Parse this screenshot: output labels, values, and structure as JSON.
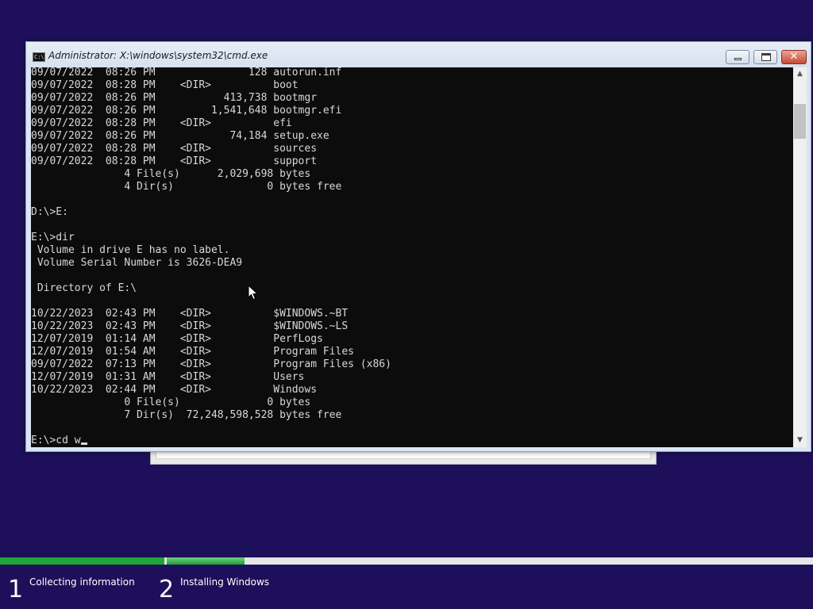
{
  "window": {
    "title": "Administrator: X:\\windows\\system32\\cmd.exe",
    "icon": "cmd-icon",
    "controls": [
      "minimize-icon",
      "maximize-icon",
      "close-icon"
    ],
    "close_glyph": "✕"
  },
  "console": {
    "lines": [
      "09/07/2022  08:26 PM               128 autorun.inf",
      "09/07/2022  08:28 PM    <DIR>          boot",
      "09/07/2022  08:26 PM           413,738 bootmgr",
      "09/07/2022  08:26 PM         1,541,648 bootmgr.efi",
      "09/07/2022  08:28 PM    <DIR>          efi",
      "09/07/2022  08:26 PM            74,184 setup.exe",
      "09/07/2022  08:28 PM    <DIR>          sources",
      "09/07/2022  08:28 PM    <DIR>          support",
      "               4 File(s)      2,029,698 bytes",
      "               4 Dir(s)               0 bytes free",
      "",
      "D:\\>E:",
      "",
      "E:\\>dir",
      " Volume in drive E has no label.",
      " Volume Serial Number is 3626-DEA9",
      "",
      " Directory of E:\\",
      "",
      "10/22/2023  02:43 PM    <DIR>          $WINDOWS.~BT",
      "10/22/2023  02:43 PM    <DIR>          $WINDOWS.~LS",
      "12/07/2019  01:14 AM    <DIR>          PerfLogs",
      "12/07/2019  01:54 AM    <DIR>          Program Files",
      "09/07/2022  07:13 PM    <DIR>          Program Files (x86)",
      "12/07/2019  01:31 AM    <DIR>          Users",
      "10/22/2023  02:44 PM    <DIR>          Windows",
      "               0 File(s)              0 bytes",
      "               7 Dir(s)  72,248,598,528 bytes free",
      ""
    ],
    "prompt_input": "E:\\>cd w"
  },
  "scrollbar": {
    "up_glyph": "▲",
    "down_glyph": "▼"
  },
  "setup_progress": {
    "steps": [
      {
        "number": "1",
        "label": "Collecting information",
        "progress": 1.0
      },
      {
        "number": "2",
        "label": "Installing Windows",
        "progress": 0.12
      }
    ],
    "accent": "#21a43a"
  },
  "colors": {
    "desktop_background": "#1e0f5a",
    "console_background": "#0c0c0c",
    "console_text": "#d8d8d8"
  }
}
